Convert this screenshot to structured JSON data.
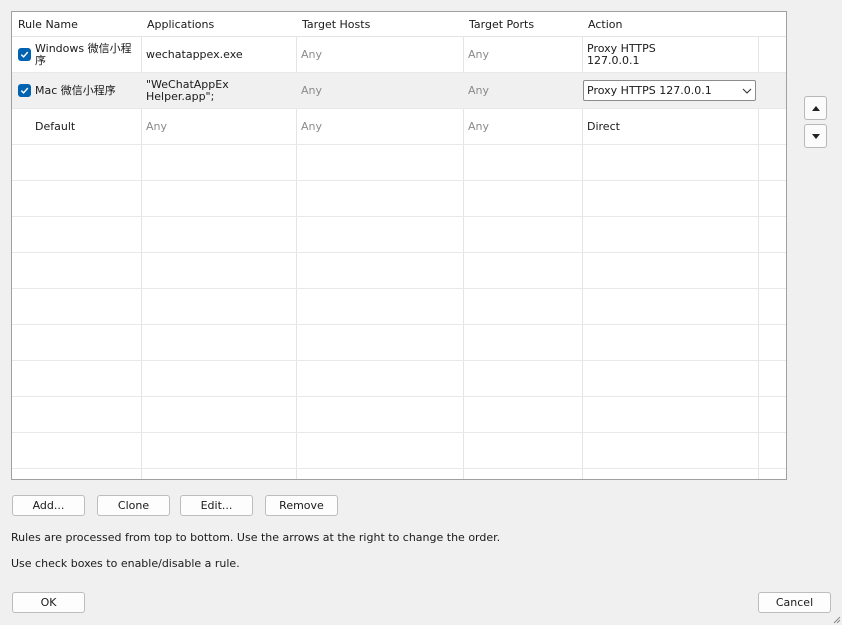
{
  "table": {
    "columns": [
      "Rule Name",
      "Applications",
      "Target Hosts",
      "Target Ports",
      "Action"
    ],
    "rows": [
      {
        "checked": true,
        "name": "Windows 微信小程序",
        "applications": "wechatappex.exe",
        "hosts": "Any",
        "ports": "Any",
        "action": "Proxy HTTPS 127.0.0.1"
      },
      {
        "checked": true,
        "selected": true,
        "name": "Mac 微信小程序",
        "applications": "\"WeChatAppEx Helper.app\"; \"WeChatAppEx Helper\"; co...",
        "hosts": "Any",
        "ports": "Any",
        "action": "Proxy HTTPS 127.0.0.1"
      },
      {
        "checked": false,
        "name": "Default",
        "applications": "Any",
        "hosts": "Any",
        "ports": "Any",
        "action": "Direct"
      }
    ]
  },
  "buttons": {
    "add": "Add...",
    "clone": "Clone",
    "edit": "Edit...",
    "remove": "Remove",
    "ok": "OK",
    "cancel": "Cancel"
  },
  "info": {
    "line1": "Rules are processed from top to bottom. Use the arrows at the right to change the order.",
    "line2": "Use check boxes to enable/disable a rule."
  },
  "icons": {
    "move_up": "arrow-up-icon",
    "move_down": "arrow-down-icon",
    "dropdown": "chevron-down-icon",
    "check": "checkmark-icon"
  },
  "colors": {
    "accent": "#0063b1",
    "selected_row": "#f0f0f0",
    "muted_text": "#8a8a8a"
  }
}
